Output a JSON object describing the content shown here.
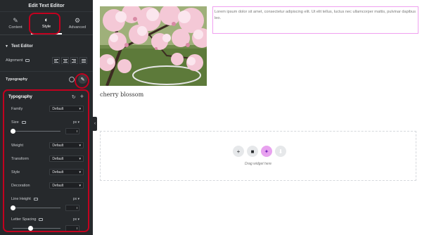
{
  "panel": {
    "title": "Edit Text Editor",
    "tabs": [
      {
        "label": "Content",
        "icon": "pencil-icon",
        "glyph": "✎"
      },
      {
        "label": "Style",
        "icon": "half-circle-icon",
        "glyph": "◐"
      },
      {
        "label": "Advanced",
        "icon": "gear-icon",
        "glyph": "⚙"
      }
    ],
    "section": "Text Editor",
    "alignment_label": "Alignment",
    "typography_label": "Typography"
  },
  "popover": {
    "title": "Typography",
    "fields": {
      "family": {
        "label": "Family",
        "value": "Default"
      },
      "size": {
        "label": "Size",
        "unit": "px"
      },
      "weight": {
        "label": "Weight",
        "value": "Default"
      },
      "transform": {
        "label": "Transform",
        "value": "Default"
      },
      "style": {
        "label": "Style",
        "value": "Default"
      },
      "decoration": {
        "label": "Decoration",
        "value": "Default"
      },
      "line_height": {
        "label": "Line Height",
        "unit": "px"
      },
      "letter_spacing": {
        "label": "Letter Spacing",
        "unit": "px"
      }
    }
  },
  "canvas": {
    "caption": "cherry blossom",
    "text": "Lorem ipsum dolor sit amet, consectetur adipiscing elit. Ut elit tellus, luctus nec ullamcorper mattis, pulvinar dapibus leo.",
    "drop_label": "Drag widget here"
  },
  "colors": {
    "panel_bg": "#26292c",
    "highlight_ring": "#c2001f",
    "text_border": "#f0a0f0",
    "ai_button": "#e8a2ef"
  }
}
